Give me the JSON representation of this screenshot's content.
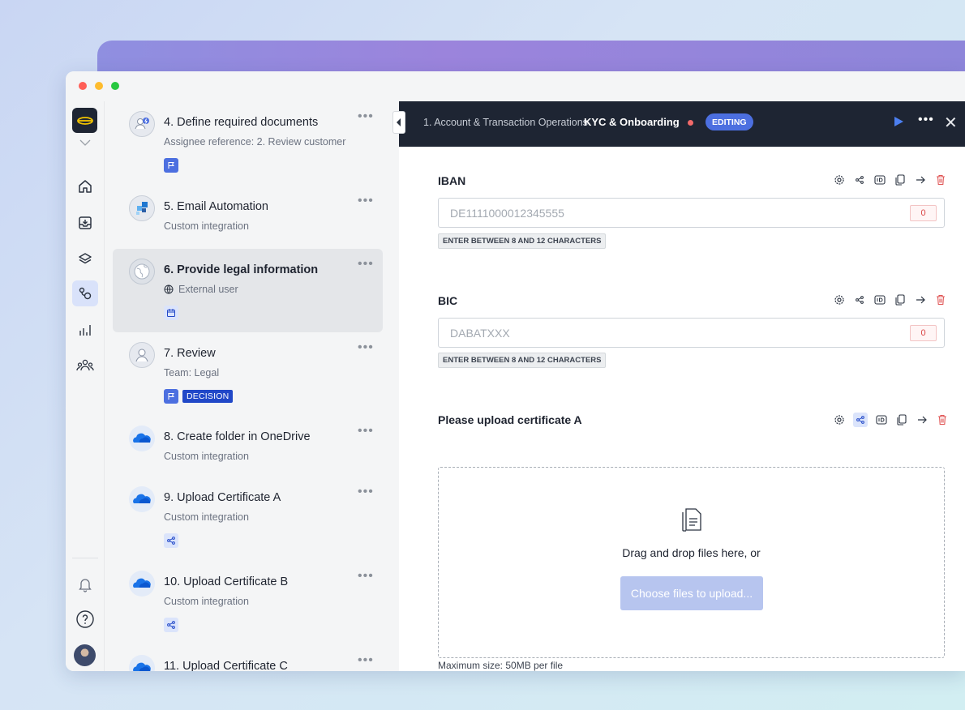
{
  "window": {
    "title": ""
  },
  "sidebar": {
    "items": [
      {
        "name": "home"
      },
      {
        "name": "inbox"
      },
      {
        "name": "layers"
      },
      {
        "name": "workflows",
        "active": true
      },
      {
        "name": "analytics"
      },
      {
        "name": "team"
      }
    ]
  },
  "steps": [
    {
      "title": "4. Define required documents",
      "subtitle": "Assignee reference: 2. Review customer",
      "icon": "user-icon"
    },
    {
      "title": "5. Email Automation",
      "subtitle": "Custom integration",
      "icon": "integration-icon"
    },
    {
      "title": "6. Provide legal information",
      "subtitle": "External user",
      "icon": "globe-icon",
      "selected": true
    },
    {
      "title": "7. Review",
      "subtitle": "Team: Legal",
      "icon": "user-icon",
      "badge": "DECISION"
    },
    {
      "title": "8. Create folder in OneDrive",
      "subtitle": "Custom integration",
      "icon": "onedrive-icon"
    },
    {
      "title": "9. Upload Certificate A",
      "subtitle": "Custom integration",
      "icon": "onedrive-icon"
    },
    {
      "title": "10. Upload Certificate B",
      "subtitle": "Custom integration",
      "icon": "onedrive-icon"
    },
    {
      "title": "11. Upload Certificate C",
      "subtitle": "",
      "icon": "onedrive-icon"
    }
  ],
  "header": {
    "breadcrumb": "1. Account & Transaction Operations",
    "current": "KYC & Onboarding",
    "status": "EDITING"
  },
  "fields": [
    {
      "label": "IBAN",
      "placeholder": "DE1111000012345555",
      "count": "0",
      "hint": "ENTER BETWEEN 8 AND 12 CHARACTERS"
    },
    {
      "label": "BIC",
      "placeholder": "DABATXXX",
      "count": "0",
      "hint": "ENTER BETWEEN 8 AND 12 CHARACTERS"
    }
  ],
  "upload": {
    "label": "Please upload certificate A",
    "drop_text": "Drag and drop files here, or",
    "button": "Choose files to upload...",
    "max_size": "Maximum size: 50MB per file"
  },
  "colors": {
    "accent": "#4c6fe0",
    "header_bg": "#1e2533",
    "danger": "#e05555"
  }
}
